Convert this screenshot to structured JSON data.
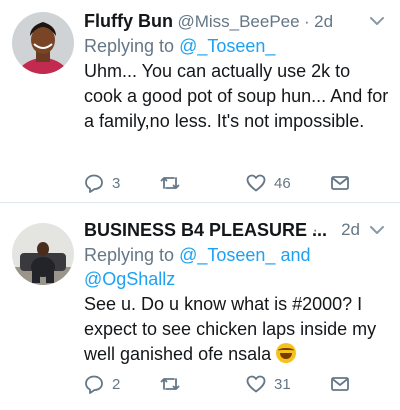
{
  "tweets": [
    {
      "name": "Fluffy Bun",
      "handle": "@Miss_BeePee",
      "separator": "·",
      "time": "2d",
      "replying_label": "Replying to",
      "replying_to": [
        "@_Toseen_"
      ],
      "text": "Uhm... You can actually use 2k to cook a good pot of soup hun... And for a family,no less. It's not impossible.",
      "reply_count": "3",
      "retweet_count": "",
      "like_count": "46",
      "avatar_icon": "woman-portrait-avatar"
    },
    {
      "name": "BUSINESS B4 PLEASURE ...",
      "separator": "·",
      "time": "2d",
      "replying_label": "Replying to",
      "replying_to": [
        "@_Toseen_",
        "@OgShallz"
      ],
      "replying_joiner": "and",
      "text": "See u. Do u know what is #2000? I expect to see chicken laps inside my well ganished ofe nsala",
      "emoji": "grinning-sweat-emoji",
      "reply_count": "2",
      "retweet_count": "",
      "like_count": "31",
      "avatar_icon": "man-seated-avatar"
    }
  ],
  "colors": {
    "text": "#14171a",
    "secondary": "#657786",
    "link": "#1da1f2",
    "divider": "#e1e8ed"
  }
}
